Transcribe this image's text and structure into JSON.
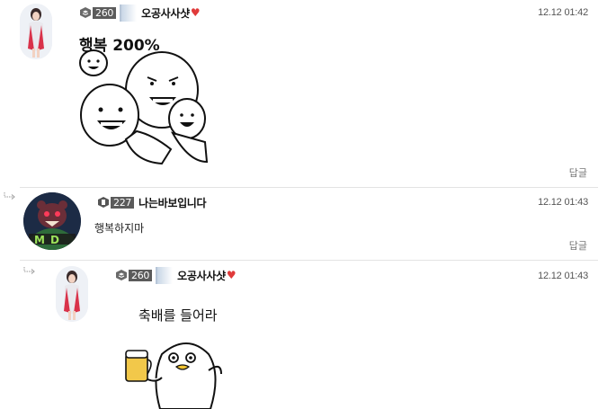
{
  "comments": [
    {
      "level": "260",
      "nickname": "오공사사샷",
      "heart": "♥",
      "time": "12.12 01:42",
      "sticker_text": "행복 200%",
      "reply_label": "답글"
    },
    {
      "level": "227",
      "nickname": "나는바보입니다",
      "time": "12.12 01:43",
      "text": "행복하지마",
      "reply_label": "답글",
      "avatar_badge": "MD"
    },
    {
      "level": "260",
      "nickname": "오공사사샷",
      "heart": "♥",
      "time": "12.12 01:43",
      "sticker_text": "축배를 들어라"
    }
  ],
  "icons": {
    "reply_indent": "reply-arrow-icon",
    "level": "level-badge-icon",
    "heart": "heart-icon"
  },
  "colors": {
    "heart": "#e03a3a",
    "divider": "#e3e3e3",
    "level_badge": "#5b5b5b"
  }
}
